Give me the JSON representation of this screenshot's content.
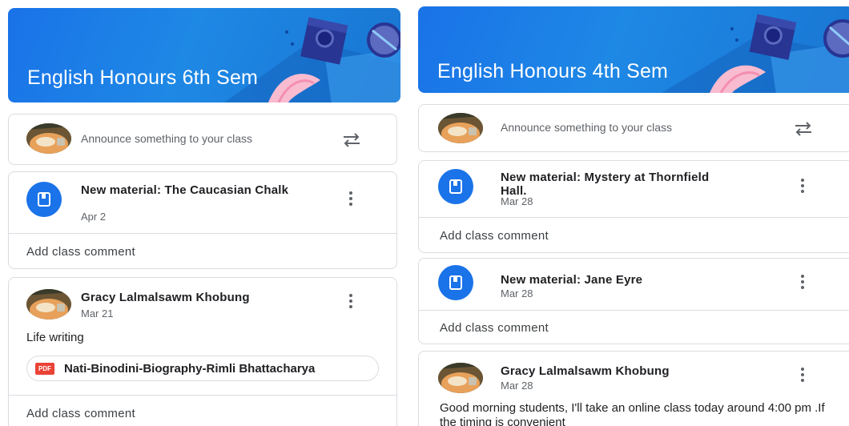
{
  "colors": {
    "accent": "#1a73e8",
    "border": "#dadce0",
    "text_secondary": "#5f6368",
    "pdf_red": "#ea4335"
  },
  "left": {
    "class_title": "English Honours 6th Sem",
    "announce_placeholder": "Announce something to your class",
    "posts": [
      {
        "type": "material",
        "title": "New material: The Caucasian Chalk",
        "date": "Apr 2",
        "comment_label": "Add class comment"
      },
      {
        "type": "announcement",
        "author": "Gracy Lalmalsawm Khobung",
        "date": "Mar 21",
        "body": "Life writing",
        "attachment": {
          "icon": "pdf-icon",
          "label": "PDF",
          "name": "Nati-Binodini-Biography-Rimli Bhattacharya"
        },
        "comment_label": "Add class comment"
      }
    ]
  },
  "right": {
    "class_title": "English Honours 4th Sem",
    "announce_placeholder": "Announce something to your class",
    "posts": [
      {
        "type": "material",
        "title": "New material: Mystery at Thornfield Hall.",
        "date": "Mar 28",
        "comment_label": "Add class comment"
      },
      {
        "type": "material",
        "title": "New material: Jane Eyre",
        "date": "Mar 28",
        "comment_label": "Add class comment"
      },
      {
        "type": "announcement",
        "author": "Gracy Lalmalsawm Khobung",
        "date": "Mar 28",
        "body": "Good morning students, I'll take an online class today around 4:00 pm .If the timing is convenient"
      }
    ]
  }
}
